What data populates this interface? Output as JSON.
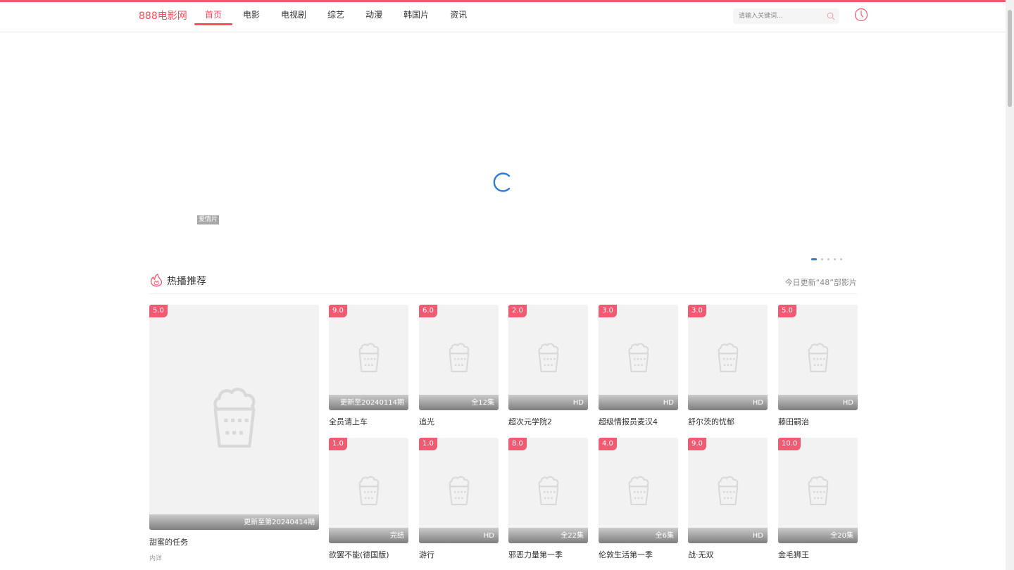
{
  "header": {
    "logo": "888电影网",
    "nav": [
      "首页",
      "电影",
      "电视剧",
      "综艺",
      "动漫",
      "韩国片",
      "资讯"
    ],
    "active_nav_index": 0,
    "search_placeholder": "请输入关键词...",
    "accent_color": "#f05b72"
  },
  "banner": {
    "tag": "爱情片",
    "dot_count": 5,
    "active_dot": 0
  },
  "hot_section": {
    "title": "热播推荐",
    "update_text": "今日更新“48”部影片",
    "featured": {
      "score": "5.0",
      "note": "更新至第20240414期",
      "title": "甜蜜的任务",
      "sub": "内详"
    },
    "items": [
      {
        "score": "9.0",
        "note": "更新至20240114期",
        "title": "全员请上车"
      },
      {
        "score": "6.0",
        "note": "全12集",
        "title": "追光"
      },
      {
        "score": "2.0",
        "note": "HD",
        "title": "超次元学院2"
      },
      {
        "score": "3.0",
        "note": "HD",
        "title": "超级情报员麦汉4"
      },
      {
        "score": "3.0",
        "note": "HD",
        "title": "舒尔茨的忧郁"
      },
      {
        "score": "5.0",
        "note": "HD",
        "title": "藤田嗣治"
      },
      {
        "score": "1.0",
        "note": "完结",
        "title": "欲罢不能(德国版)"
      },
      {
        "score": "1.0",
        "note": "HD",
        "title": "游行"
      },
      {
        "score": "8.0",
        "note": "全22集",
        "title": "邪恶力量第一季"
      },
      {
        "score": "4.0",
        "note": "全6集",
        "title": "伦敦生活第一季"
      },
      {
        "score": "9.0",
        "note": "HD",
        "title": "战·无双"
      },
      {
        "score": "10.0",
        "note": "全20集",
        "title": "金毛狮王"
      }
    ]
  }
}
